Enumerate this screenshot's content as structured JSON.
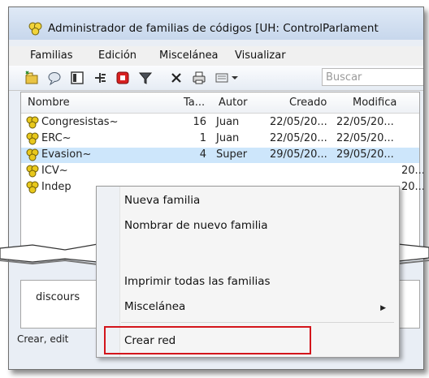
{
  "window": {
    "title": "Administrador de familias de códigos [UH: ControlParlament"
  },
  "menubar": {
    "items": [
      "Familias",
      "Edición",
      "Miscelánea",
      "Visualizar"
    ]
  },
  "toolbar": {
    "search_placeholder": "Buscar",
    "icons": [
      "new-family-icon",
      "comment-icon",
      "card-icon",
      "tree-icon",
      "delete-family-icon",
      "filter-icon",
      "close-icon",
      "print-icon",
      "view-options-icon"
    ]
  },
  "list": {
    "columns": [
      "Nombre",
      "Ta...",
      "Autor",
      "Creado",
      "Modifica"
    ],
    "rows": [
      {
        "name": "Congresistas~",
        "count": "16",
        "author": "Juan",
        "created": "22/05/20...",
        "modified": "22/05/20..."
      },
      {
        "name": "ERC~",
        "count": "1",
        "author": "Juan",
        "created": "22/05/20...",
        "modified": "22/05/20..."
      },
      {
        "name": "Evasion~",
        "count": "4",
        "author": "Super",
        "created": "29/05/20...",
        "modified": "29/05/20..."
      },
      {
        "name": "ICV~",
        "count": "",
        "author": "",
        "created": "",
        "modified": "20..."
      },
      {
        "name": "Indep",
        "count": "",
        "author": "",
        "created": "",
        "modified": "20..."
      }
    ]
  },
  "lower_pane": {
    "text": "discours"
  },
  "statusbar": {
    "text": "Crear, edit"
  },
  "context_menu": {
    "items": [
      "Nueva familia",
      "Nombrar de nuevo familia",
      "Imprimir todas las familias",
      "Miscelánea",
      "Crear red"
    ],
    "submenu_arrow": "▶"
  },
  "colors": {
    "highlight": "#d3151b",
    "selection": "#cde6fb",
    "icon_yellow": "#e8c81c"
  }
}
